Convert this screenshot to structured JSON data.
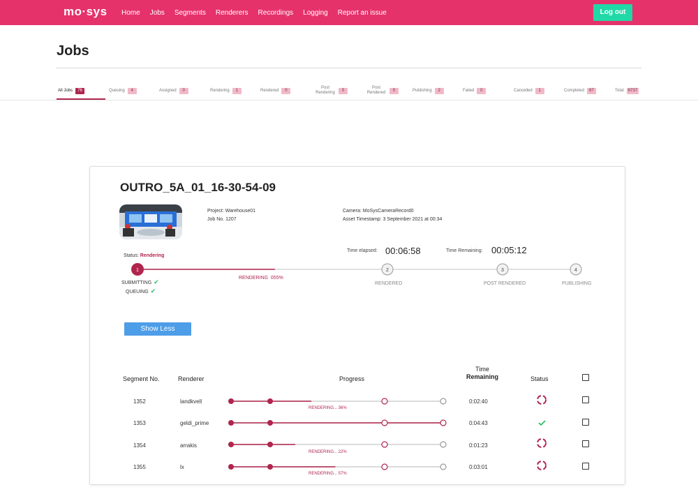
{
  "nav": {
    "logo": "mo·sys",
    "links": [
      "Home",
      "Jobs",
      "Segments",
      "Renderers",
      "Recordings",
      "Logging",
      "Report an issue"
    ],
    "logout": "Log out"
  },
  "page": {
    "title": "Jobs"
  },
  "tabs": [
    {
      "label": "All Jobs",
      "count": "76",
      "active": true
    },
    {
      "label": "Queuing",
      "count": "4"
    },
    {
      "label": "Assigned",
      "count": "0"
    },
    {
      "label": "Rendering",
      "count": "1"
    },
    {
      "label": "Rendered",
      "count": "0"
    },
    {
      "label": "Post Rendering",
      "count": "0"
    },
    {
      "label": "Post Rendered",
      "count": "0"
    },
    {
      "label": "Publishing",
      "count": "2"
    },
    {
      "label": "Failed",
      "count": "0"
    },
    {
      "label": "Cancelled",
      "count": "1"
    },
    {
      "label": "Completed",
      "count": "67"
    },
    {
      "label": "Total",
      "count": "6737"
    }
  ],
  "job": {
    "title": "OUTRO_5A_01_16-30-54-09",
    "project": "Project: Warehouse01",
    "job_no": "Job No. 1207",
    "camera": "Camera: MoSysCameraRecord0",
    "asset_ts": "Asset Timestamp: 3 September 2021 at 00:34",
    "status_label": "Status:",
    "status_value": "Rendering",
    "elapsed_label": "Time elapsed:",
    "elapsed": "00:06:58",
    "remaining_label": "Time Remaining:",
    "remaining": "00:05:12",
    "steps": [
      {
        "num": "1",
        "caption": ""
      },
      {
        "num": "2",
        "caption": "RENDERED"
      },
      {
        "num": "3",
        "caption": "POST RENDERED"
      },
      {
        "num": "4",
        "caption": "PUBLISHING"
      }
    ],
    "substeps": [
      "SUBMITTING",
      "QUEUING"
    ],
    "rendering_caption": "RENDERING",
    "rendering_pct": "055%",
    "rendering_progress": 0.55,
    "show_less": "Show Less"
  },
  "table": {
    "headers": {
      "segment": "Segment No.",
      "renderer": "Renderer",
      "progress": "Progress",
      "time_top": "Time",
      "time_bottom": "Remaining",
      "status": "Status"
    },
    "rows": [
      {
        "segment": "1352",
        "renderer": "landkvell",
        "progress": 0.36,
        "caption": "RENDERING... 36%",
        "time": "0:02:40",
        "status": "spinner"
      },
      {
        "segment": "1353",
        "renderer": "geldi_prime",
        "progress": 1.0,
        "caption": "",
        "time": "0:04:43",
        "status": "check"
      },
      {
        "segment": "1354",
        "renderer": "arrakis",
        "progress": 0.22,
        "caption": "RENDERING... 22%",
        "time": "0:01:23",
        "status": "spinner"
      },
      {
        "segment": "1355",
        "renderer": "lx",
        "progress": 0.57,
        "caption": "RENDERING... 57%",
        "time": "0:03:01",
        "status": "spinner"
      }
    ]
  },
  "colors": {
    "brand": "#e5326a",
    "accent": "#b0254e",
    "logout": "#21d9a7",
    "button": "#4d9de8"
  }
}
